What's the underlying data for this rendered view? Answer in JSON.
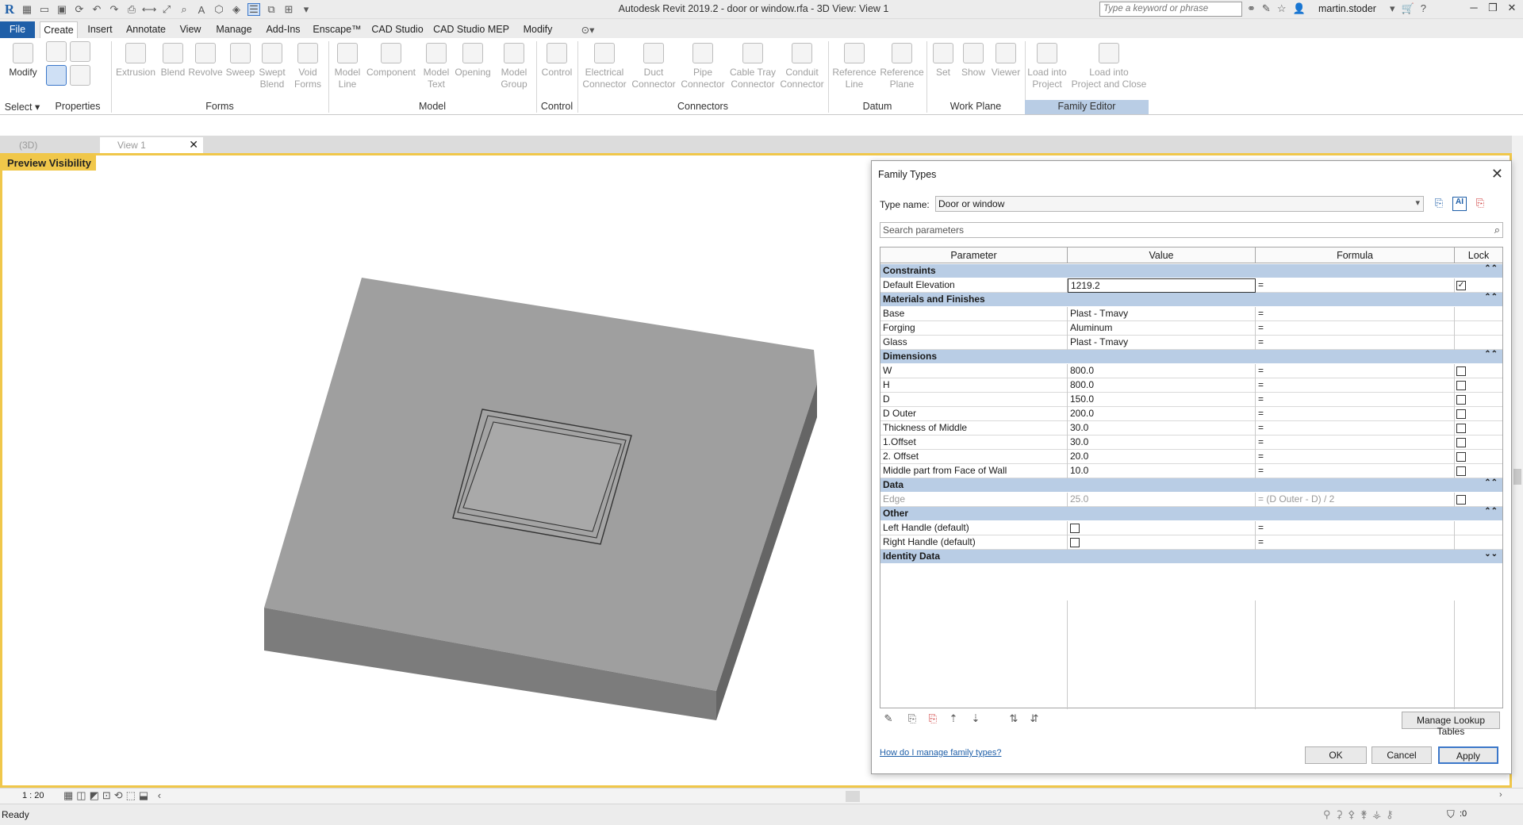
{
  "window": {
    "title": "Autodesk Revit 2019.2 - door or window.rfa - 3D View: View 1",
    "search_placeholder": "Type a keyword or phrase",
    "user": "martin.stoder"
  },
  "menu": {
    "tabs": [
      "File",
      "Create",
      "Insert",
      "Annotate",
      "View",
      "Manage",
      "Add-Ins",
      "Enscape™",
      "CAD Studio",
      "CAD Studio MEP",
      "Modify"
    ],
    "active": "Create"
  },
  "ribbon": {
    "buttons": [
      {
        "label": "Modify",
        "enabled": true
      },
      {
        "label": "Extrusion",
        "enabled": false
      },
      {
        "label": "Blend",
        "enabled": false
      },
      {
        "label": "Revolve",
        "enabled": false
      },
      {
        "label": "Sweep",
        "enabled": false
      },
      {
        "label": "Swept\nBlend",
        "enabled": false
      },
      {
        "label": "Void\nForms",
        "enabled": false
      },
      {
        "label": "Model\nLine",
        "enabled": false
      },
      {
        "label": "Component",
        "enabled": false
      },
      {
        "label": "Model\nText",
        "enabled": false
      },
      {
        "label": "Opening",
        "enabled": false
      },
      {
        "label": "Model\nGroup",
        "enabled": false
      },
      {
        "label": "Control",
        "enabled": false
      },
      {
        "label": "Electrical\nConnector",
        "enabled": false
      },
      {
        "label": "Duct\nConnector",
        "enabled": false
      },
      {
        "label": "Pipe\nConnector",
        "enabled": false
      },
      {
        "label": "Cable Tray\nConnector",
        "enabled": false
      },
      {
        "label": "Conduit\nConnector",
        "enabled": false
      },
      {
        "label": "Reference\nLine",
        "enabled": false
      },
      {
        "label": "Reference\nPlane",
        "enabled": false
      },
      {
        "label": "Set",
        "enabled": false
      },
      {
        "label": "Show",
        "enabled": false
      },
      {
        "label": "Viewer",
        "enabled": false
      },
      {
        "label": "Load into\nProject",
        "enabled": false
      },
      {
        "label": "Load into\nProject and Close",
        "enabled": false
      }
    ],
    "panels": [
      "Select",
      "Properties",
      "Forms",
      "Model",
      "Control",
      "Connectors",
      "Datum",
      "Work Plane",
      "Family Editor"
    ]
  },
  "view_tabs": [
    {
      "label": "(3D)"
    },
    {
      "label": "View 1"
    }
  ],
  "viewport": {
    "preview_label": "Preview Visibility",
    "scale": "1 : 20"
  },
  "status": {
    "text": "Ready",
    "filter_count": ":0"
  },
  "dialog": {
    "title": "Family Types",
    "type_name_label": "Type name:",
    "type_name_value": "Door or window",
    "search_placeholder": "Search parameters",
    "columns": [
      "Parameter",
      "Value",
      "Formula",
      "Lock"
    ],
    "groups": [
      {
        "name": "Constraints",
        "rows": [
          {
            "param": "Default Elevation",
            "value": "1219.2",
            "formula": "=",
            "lock": "checked"
          }
        ]
      },
      {
        "name": "Materials and Finishes",
        "rows": [
          {
            "param": "Base",
            "value": "Plast - Tmavy",
            "formula": "=",
            "lock": "none"
          },
          {
            "param": "Forging",
            "value": "Aluminum",
            "formula": "=",
            "lock": "none"
          },
          {
            "param": "Glass",
            "value": "Plast - Tmavy",
            "formula": "=",
            "lock": "none"
          }
        ]
      },
      {
        "name": "Dimensions",
        "rows": [
          {
            "param": "W",
            "value": "800.0",
            "formula": "=",
            "lock": "unchecked"
          },
          {
            "param": "H",
            "value": "800.0",
            "formula": "=",
            "lock": "unchecked"
          },
          {
            "param": "D",
            "value": "150.0",
            "formula": "=",
            "lock": "unchecked"
          },
          {
            "param": "D Outer",
            "value": "200.0",
            "formula": "=",
            "lock": "unchecked"
          },
          {
            "param": "Thickness of Middle",
            "value": "30.0",
            "formula": "=",
            "lock": "unchecked"
          },
          {
            "param": "1.Offset",
            "value": "30.0",
            "formula": "=",
            "lock": "unchecked"
          },
          {
            "param": "2. Offset",
            "value": "20.0",
            "formula": "=",
            "lock": "unchecked"
          },
          {
            "param": "Middle part from Face of Wall",
            "value": "10.0",
            "formula": "=",
            "lock": "unchecked"
          }
        ]
      },
      {
        "name": "Data",
        "rows": [
          {
            "param": "Edge",
            "value": "25.0",
            "formula": "= (D Outer - D) / 2",
            "lock": "unchecked",
            "disabled": true
          }
        ]
      },
      {
        "name": "Other",
        "rows": [
          {
            "param": "Left Handle (default)",
            "value": "",
            "formula": "=",
            "lock": "none",
            "value_checkbox": true
          },
          {
            "param": "Right Handle (default)",
            "value": "",
            "formula": "=",
            "lock": "none",
            "value_checkbox": true
          }
        ]
      },
      {
        "name": "Identity Data",
        "rows": [],
        "collapsed": true
      }
    ],
    "manage_lookup": "Manage Lookup Tables",
    "help_link": "How do I manage family types?",
    "ok": "OK",
    "cancel": "Cancel",
    "apply": "Apply"
  }
}
